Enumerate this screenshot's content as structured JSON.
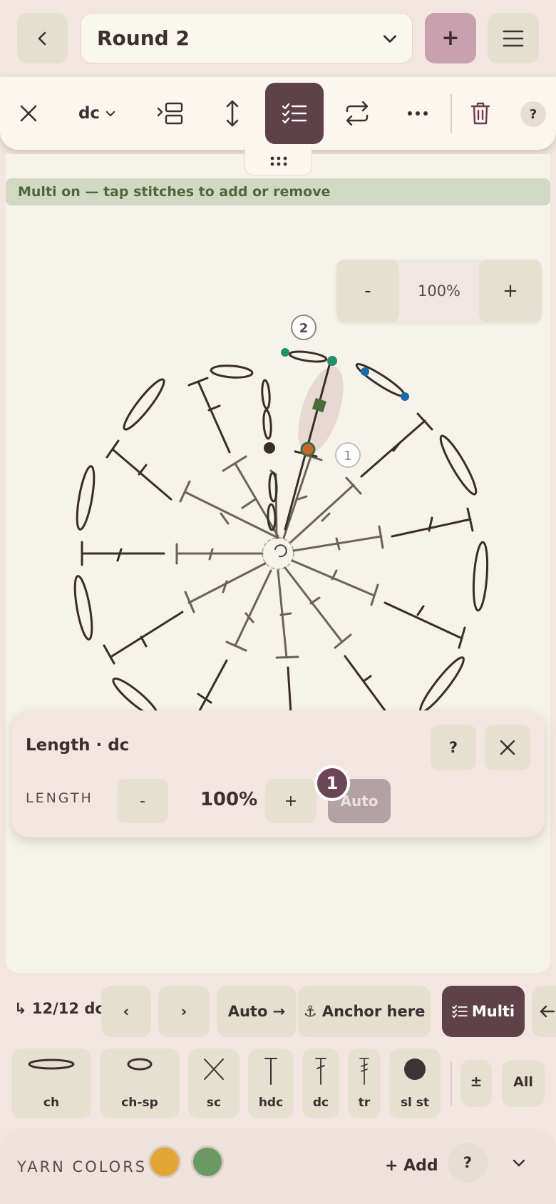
{
  "topbar": {
    "round_label": "Round 2",
    "add_label": "+",
    "accent": "#c9a0ad"
  },
  "toolbar": {
    "stitch_selector": "dc",
    "help_label": "?"
  },
  "banner": {
    "text": "Multi on — tap stitches to add or remove"
  },
  "zoom": {
    "minus": "-",
    "value": "100%",
    "plus": "+"
  },
  "chart_labels": {
    "round2": "2",
    "round1": "1"
  },
  "length_panel": {
    "title": "Length · dc",
    "help": "?",
    "label": "LENGTH",
    "minus": "-",
    "value": "100%",
    "plus": "+",
    "auto": "Auto",
    "step_badge": "1"
  },
  "row1": {
    "counter": "↳ 12/12 dc",
    "prev": "‹",
    "next": "›",
    "auto_next": "Auto →",
    "anchor": "⚓ Anchor here",
    "multi": "Multi"
  },
  "stitches": [
    {
      "label": "ch",
      "icon": "chain-oval-icon"
    },
    {
      "label": "ch-sp",
      "icon": "chain-space-icon"
    },
    {
      "label": "sc",
      "icon": "single-crochet-icon"
    },
    {
      "label": "hdc",
      "icon": "half-double-crochet-icon"
    },
    {
      "label": "dc",
      "icon": "double-crochet-icon"
    },
    {
      "label": "tr",
      "icon": "treble-crochet-icon"
    },
    {
      "label": "sl st",
      "icon": "slip-stitch-icon"
    }
  ],
  "stitch_extras": {
    "plusminus": "±",
    "all": "All"
  },
  "yarn": {
    "label": "YARN COLORS",
    "colors": [
      "#e1a634",
      "#6a9a64"
    ],
    "add": "+ Add",
    "help": "?"
  }
}
